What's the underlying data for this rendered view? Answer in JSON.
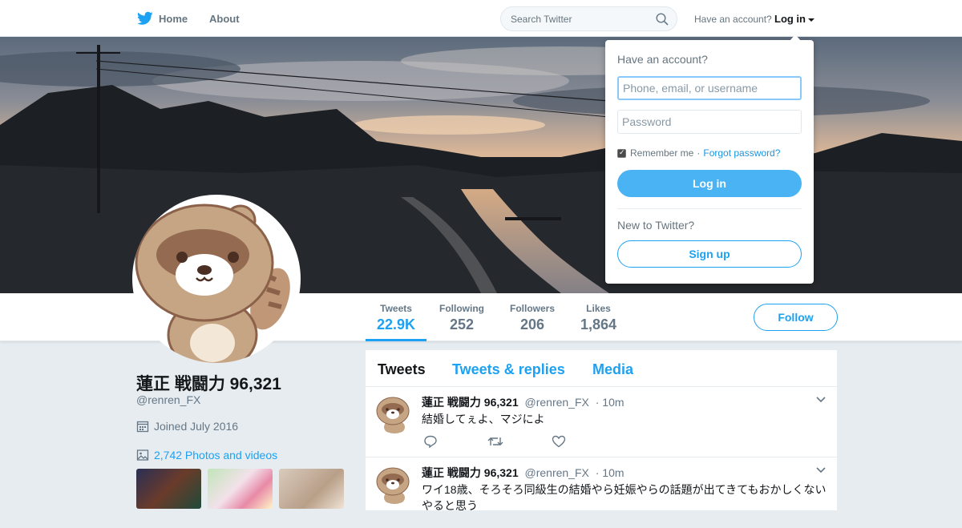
{
  "nav": {
    "home_label": "Home",
    "about_label": "About",
    "search_placeholder": "Search Twitter",
    "have_account_text": "Have an account?",
    "login_label": "Log in",
    "brand_color": "#1da1f2"
  },
  "login_dropdown": {
    "title": "Have an account?",
    "username_placeholder": "Phone, email, or username",
    "password_placeholder": "Password",
    "remember_label": "Remember me",
    "separator": "·",
    "forgot_label": "Forgot password?",
    "login_button": "Log in",
    "new_prompt": "New to Twitter?",
    "signup_button": "Sign up"
  },
  "stats": {
    "tweets": {
      "label": "Tweets",
      "value": "22.9K"
    },
    "following": {
      "label": "Following",
      "value": "252"
    },
    "followers": {
      "label": "Followers",
      "value": "206"
    },
    "likes": {
      "label": "Likes",
      "value": "1,864"
    },
    "follow_button": "Follow"
  },
  "profile": {
    "name": "蓮正 戦闘力 96,321",
    "handle": "@renren_FX",
    "joined": "Joined July 2016",
    "photos_link": "2,742 Photos and videos"
  },
  "timeline": {
    "tabs": [
      "Tweets",
      "Tweets & replies",
      "Media"
    ],
    "tweets": [
      {
        "name": "蓮正 戦闘力 96,321",
        "handle": "@renren_FX",
        "time": "· 10m",
        "text": "結婚してぇよ、マジによ"
      },
      {
        "name": "蓮正 戦闘力 96,321",
        "handle": "@renren_FX",
        "time": "· 10m",
        "text": "ワイ18歳、そろそろ同級生の結婚やら妊娠やらの話題が出てきてもおかしくない",
        "text2": "やると思う"
      }
    ]
  },
  "icons": [
    "twitter-bird-icon",
    "search-icon",
    "caret-down-icon",
    "calendar-icon",
    "image-icon",
    "reply-icon",
    "retweet-icon",
    "like-icon",
    "chevron-down-icon"
  ]
}
